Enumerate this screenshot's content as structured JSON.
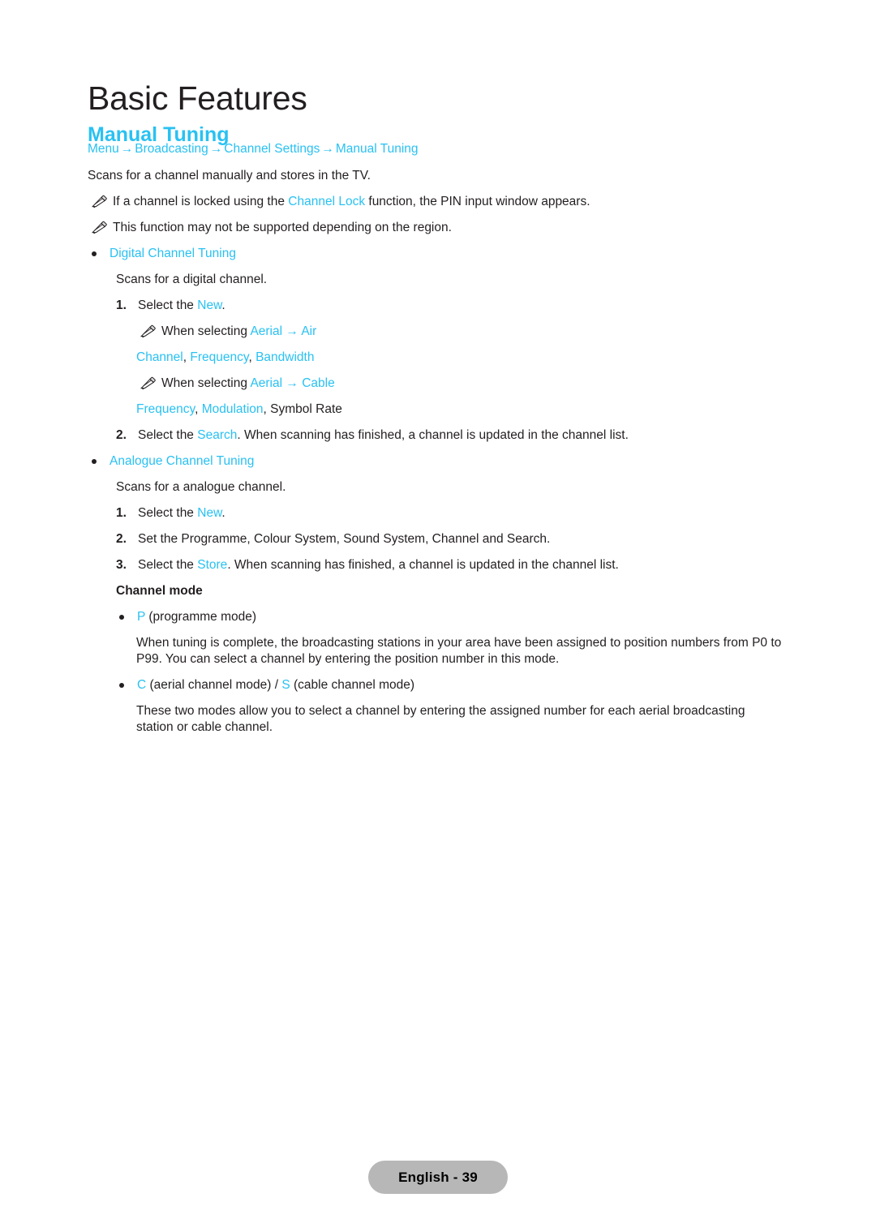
{
  "chapter": {
    "title": "Basic Features"
  },
  "section": {
    "title": "Manual Tuning"
  },
  "breadcrumb": {
    "items": [
      "Menu",
      "Broadcasting",
      "Channel Settings",
      "Manual Tuning"
    ],
    "separator": "→"
  },
  "intro": {
    "description": "Scans for a channel manually and stores in the TV."
  },
  "notes": {
    "icon": "pencil-note-icon",
    "lock_note": {
      "before": "If a channel is locked using the ",
      "link": "Channel Lock",
      "after": " function, the PIN input window appears."
    },
    "region_note": "This function may not be supported depending on the region."
  },
  "digital": {
    "heading": "Digital Channel Tuning",
    "description": "Scans for a digital channel.",
    "step1": {
      "num": "1.",
      "before": "Select the ",
      "link": "New",
      "after": "."
    },
    "aerial_air_note": {
      "before": "When selecting ",
      "link1": "Aerial",
      "arrow": " → ",
      "link2": "Air"
    },
    "air_params": {
      "p1": "Channel",
      "sep1": ", ",
      "p2": "Frequency",
      "sep2": ", ",
      "p3": "Bandwidth"
    },
    "aerial_cable_note": {
      "before": "When selecting ",
      "link1": "Aerial",
      "arrow": " → ",
      "link2": "Cable"
    },
    "cable_params": {
      "p1": "Frequency",
      "sep1": ", ",
      "p2": "Modulation",
      "sep2": ", ",
      "p3": "Symbol Rate"
    },
    "step2": {
      "num": "2.",
      "before": "Select the ",
      "link": "Search",
      "after": ". When scanning has finished, a channel is updated in the channel list."
    }
  },
  "analogue": {
    "heading": "Analogue Channel Tuning",
    "description": "Scans for a analogue channel.",
    "step1": {
      "num": "1.",
      "before": "Select the ",
      "link": "New",
      "after": "."
    },
    "step2": {
      "num": "2.",
      "text": "Set the Programme, Colour System, Sound System, Channel and Search."
    },
    "step3": {
      "num": "3.",
      "before": "Select the ",
      "link": "Store",
      "after": ". When scanning has finished, a channel is updated in the channel list."
    }
  },
  "channel_mode": {
    "heading": "Channel mode",
    "p_mode": {
      "link": "P",
      "after": " (programme mode)"
    },
    "p_mode_desc": "When tuning is complete, the broadcasting stations in your area have been assigned to position numbers from P0 to P99. You can select a channel by entering the position number in this mode.",
    "cs_mode": {
      "link1": "C",
      "mid1": " (aerial channel mode) / ",
      "link2": "S",
      "mid2": " (cable channel mode)"
    },
    "cs_mode_desc": "These two modes allow you to select a channel by entering the assigned number for each aerial broadcasting station or cable channel."
  },
  "footer": {
    "label": "English - 39"
  },
  "colors": {
    "accent": "#29c1f2",
    "text": "#231f20",
    "badge_bg": "#b7b7b7"
  }
}
